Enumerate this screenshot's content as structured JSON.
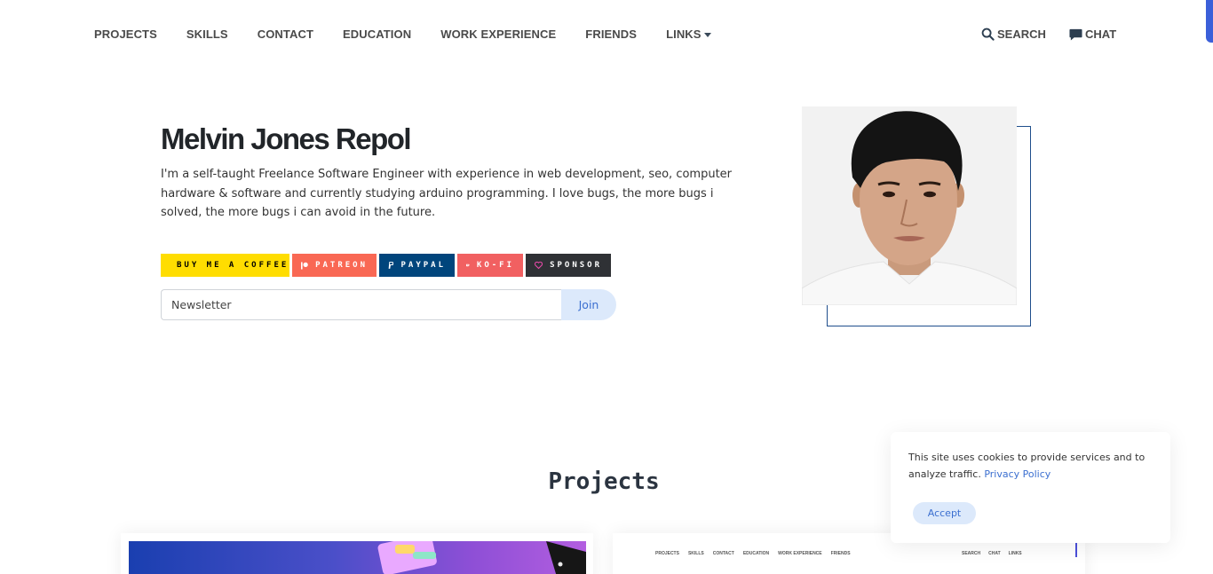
{
  "nav": {
    "items": [
      {
        "label": "PROJECTS"
      },
      {
        "label": "SKILLS"
      },
      {
        "label": "CONTACT"
      },
      {
        "label": "EDUCATION"
      },
      {
        "label": "WORK EXPERIENCE"
      },
      {
        "label": "FRIENDS"
      },
      {
        "label": "LINKS"
      }
    ],
    "search_label": "SEARCH",
    "chat_label": "CHAT"
  },
  "hero": {
    "name": "Melvin Jones Repol",
    "bio": "I'm a self-taught Freelance Software Engineer with experience in web development, seo, computer hardware & software and currently studying arduino programming. I love bugs, the more bugs i solved, the more bugs i can avoid in the future."
  },
  "donate": {
    "coffee": "BUY ME A COFFEE",
    "patreon": "PATREON",
    "paypal": "PAYPAL",
    "kofi": "KO-FI",
    "sponsor": "SPONSOR"
  },
  "newsletter": {
    "placeholder": "Newsletter",
    "button": "Join"
  },
  "projects": {
    "title": "Projects",
    "mini_nav": [
      "PROJECTS",
      "SKILLS",
      "CONTACT",
      "EDUCATION",
      "WORK EXPERIENCE",
      "FRIENDS"
    ],
    "mini_right": [
      "SEARCH",
      "CHAT",
      "LINKS"
    ]
  },
  "cookie": {
    "text": "This site uses cookies to provide services and to analyze traffic.",
    "link": "Privacy Policy",
    "accept": "Accept"
  },
  "colors": {
    "accent": "#3b6fd0",
    "frame": "#1f4e8c",
    "coffee": "#ffdd00",
    "patreon": "#f96854",
    "paypal": "#00457c",
    "kofi": "#f16061",
    "sponsor": "#2f3135"
  }
}
